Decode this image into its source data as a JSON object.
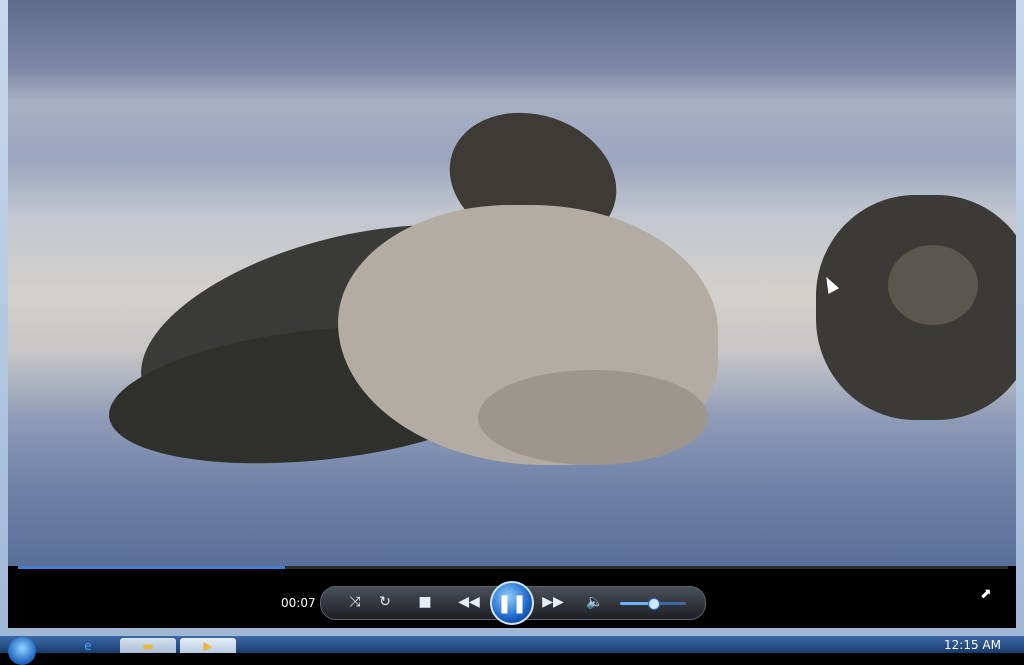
{
  "player": {
    "elapsed_time": "00:07",
    "seek_progress": 0.27,
    "volume_level": 0.5
  },
  "controls": {
    "shuffle_icon": "shuffle-icon",
    "repeat_icon": "repeat-icon",
    "stop_icon": "stop-icon",
    "previous_icon": "rewind-icon",
    "play_pause_icon": "pause-icon",
    "next_icon": "fast-forward-icon",
    "mute_icon": "speaker-icon",
    "fullscreen_icon": "switch-to-fullscreen-icon"
  },
  "taskbar": {
    "clock": "12:15 AM",
    "buttons": [
      "internet-explorer",
      "windows-explorer",
      "windows-media-player"
    ]
  },
  "colors": {
    "accent": "#3f7fd8",
    "play_button": "#1b63c9"
  }
}
